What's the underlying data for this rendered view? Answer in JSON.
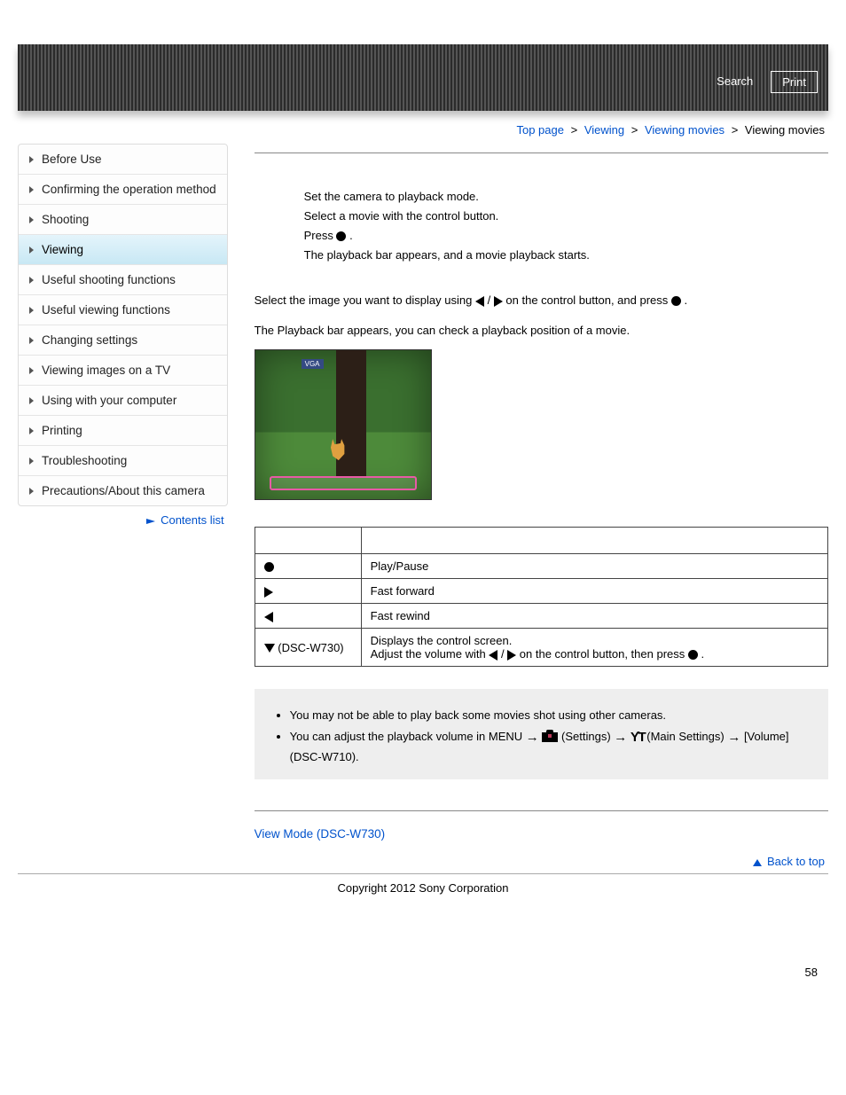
{
  "header": {
    "search": "Search",
    "print": "Print"
  },
  "breadcrumb": {
    "top": "Top page",
    "viewing": "Viewing",
    "group": "Viewing movies",
    "current": "Viewing movies",
    "sep": ">"
  },
  "sidebar": {
    "items": [
      {
        "label": "Before Use"
      },
      {
        "label": "Confirming the operation method"
      },
      {
        "label": "Shooting"
      },
      {
        "label": "Viewing"
      },
      {
        "label": "Useful shooting functions"
      },
      {
        "label": "Useful viewing functions"
      },
      {
        "label": "Changing settings"
      },
      {
        "label": "Viewing images on a TV"
      },
      {
        "label": "Using with your computer"
      },
      {
        "label": "Printing"
      },
      {
        "label": "Troubleshooting"
      },
      {
        "label": "Precautions/About this camera"
      }
    ],
    "contents_list": "Contents list"
  },
  "steps": {
    "s1": "Set the camera to playback mode.",
    "s2": "Select a movie with the control button.",
    "s3a": "Press ",
    "s3b": ".",
    "s3c": "The playback bar appears, and a movie playback starts."
  },
  "body": {
    "p1a": "Select the image you want to display using ",
    "p1b": " / ",
    "p1c": " on the control button, and press ",
    "p1d": ".",
    "p2": "The Playback bar appears, you can check a playback position of a movie."
  },
  "table": {
    "r1": {
      "label": "",
      "desc": "Play/Pause"
    },
    "r2": {
      "label": "",
      "desc": "Fast forward"
    },
    "r3": {
      "label": "",
      "desc": "Fast rewind"
    },
    "r4": {
      "label": " (DSC-W730)",
      "d1": "Displays the control screen.",
      "d2a": "Adjust the volume with ",
      "d2b": " / ",
      "d2c": " on the control button, then press ",
      "d2d": "."
    }
  },
  "notes": {
    "n1": "You may not be able to play back some movies shot using other cameras.",
    "n2a": "You can adjust the playback volume in MENU ",
    "n2b": "(Settings) ",
    "n2c": "(Main Settings) ",
    "n2d": " [Volume] (DSC-W710)."
  },
  "related": {
    "link": "View Mode (DSC-W730)"
  },
  "backtop": "Back to top",
  "copyright": "Copyright 2012 Sony Corporation",
  "pageno": "58"
}
